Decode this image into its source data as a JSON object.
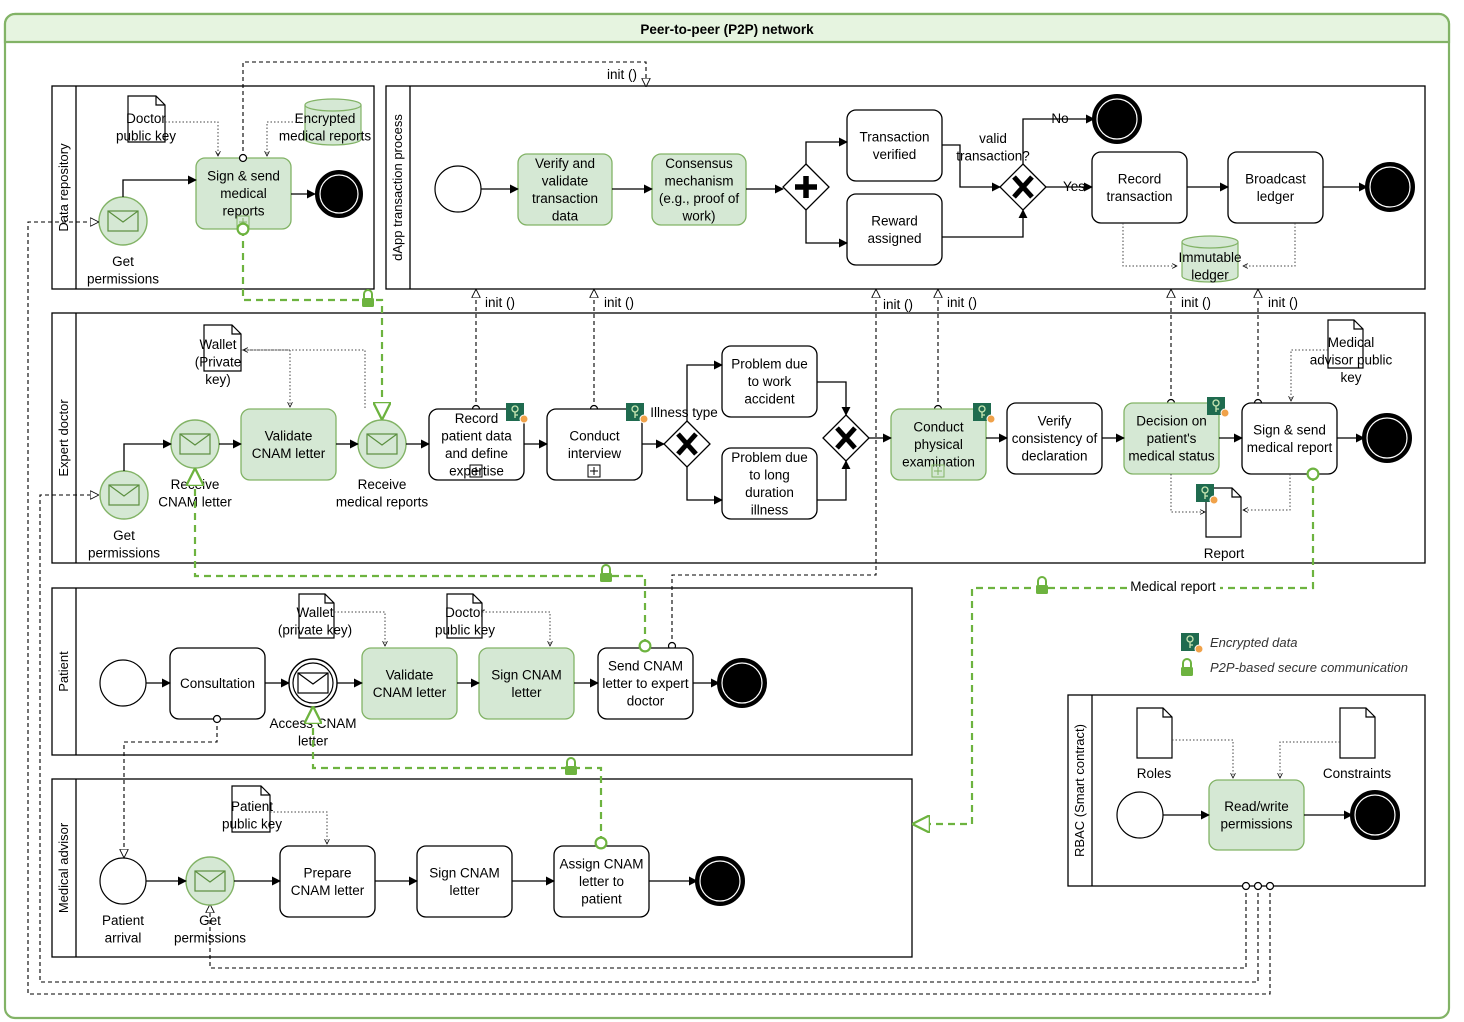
{
  "colors": {
    "green_fill": "#d5e8d4",
    "green_stroke": "#82b366",
    "green_link": "#6db33f",
    "key_fill": "#1f6b4f",
    "outer_fill": "#ffffff",
    "header_fill": "#e6f4e0"
  },
  "network": {
    "title": "Peer-to-peer (P2P) network"
  },
  "pools": {
    "data_repository": "Data repository",
    "dapp": "dApp transaction process",
    "expert_doctor": "Expert doctor",
    "patient": "Patient",
    "medical_advisor": "Medical advisor",
    "rbac": "RBAC (Smart contract)"
  },
  "data_repository": {
    "doctor_public_key": [
      "Doctor",
      "public key"
    ],
    "encrypted_reports": [
      "Encrypted",
      "medical reports"
    ],
    "sign_send": [
      "Sign & send",
      "medical",
      "reports"
    ],
    "get_permissions": [
      "Get",
      "permissions"
    ]
  },
  "dapp": {
    "verify": [
      "Verify and",
      "validate",
      "transaction",
      "data"
    ],
    "consensus": [
      "Consensus",
      "mechanism",
      "(e.g., proof of",
      "work)"
    ],
    "tx_verified": [
      "Transaction",
      "verified"
    ],
    "reward": [
      "Reward",
      "assigned"
    ],
    "valid_q": [
      "valid",
      "transaction?"
    ],
    "no": "No",
    "yes": "Yes",
    "record_tx": [
      "Record",
      "transaction"
    ],
    "broadcast": [
      "Broadcast",
      "ledger"
    ],
    "ledger": [
      "Immutable",
      "ledger"
    ]
  },
  "init_label": "init ()",
  "expert": {
    "wallet": [
      "Wallet",
      "(Private",
      "key)"
    ],
    "get_permissions": [
      "Get",
      "permissions"
    ],
    "receive_cnam": [
      "Receive",
      "CNAM letter"
    ],
    "validate": [
      "Validate",
      "CNAM letter"
    ],
    "receive_reports": [
      "Receive",
      "medical reports"
    ],
    "record": [
      "Record",
      "patient data",
      "and define",
      "expertise"
    ],
    "interview": [
      "Conduct",
      "interview"
    ],
    "illness_type": "Illness type",
    "work_accident": [
      "Problem due",
      "to work",
      "accident"
    ],
    "long_illness": [
      "Problem due",
      "to long",
      "duration",
      "illness"
    ],
    "exam": [
      "Conduct",
      "physical",
      "examination"
    ],
    "verify_consistency": [
      "Verify",
      "consistency of",
      "declaration"
    ],
    "decision": [
      "Decision on",
      "patient's",
      "medical status"
    ],
    "sign_send": [
      "Sign & send",
      "medical report"
    ],
    "advisor_key": [
      "Medical",
      "advisor public",
      "key"
    ],
    "report": "Report"
  },
  "medical_report_label": "Medical report",
  "legend": {
    "encrypted": "Encrypted data",
    "p2p": "P2P-based secure communication"
  },
  "patient": {
    "consultation": "Consultation",
    "wallet": [
      "Wallet",
      "(private key)"
    ],
    "doctor_key": [
      "Doctor",
      "public key"
    ],
    "access": [
      "Access  CNAM",
      "letter"
    ],
    "validate": [
      "Validate",
      "CNAM letter"
    ],
    "sign": [
      "Sign CNAM",
      "letter"
    ],
    "send": [
      "Send CNAM",
      "letter to expert",
      "doctor"
    ]
  },
  "advisor": {
    "patient_key": [
      "Patient",
      "public key"
    ],
    "arrival": [
      "Patient",
      "arrival"
    ],
    "get_permissions": [
      "Get",
      "permissions"
    ],
    "prepare": [
      "Prepare",
      "CNAM letter"
    ],
    "sign": [
      "Sign CNAM",
      "letter"
    ],
    "assign": [
      "Assign CNAM",
      "letter to",
      "patient"
    ]
  },
  "rbac": {
    "roles": "Roles",
    "constraints": "Constraints",
    "rw": [
      "Read/write",
      "permissions"
    ]
  }
}
